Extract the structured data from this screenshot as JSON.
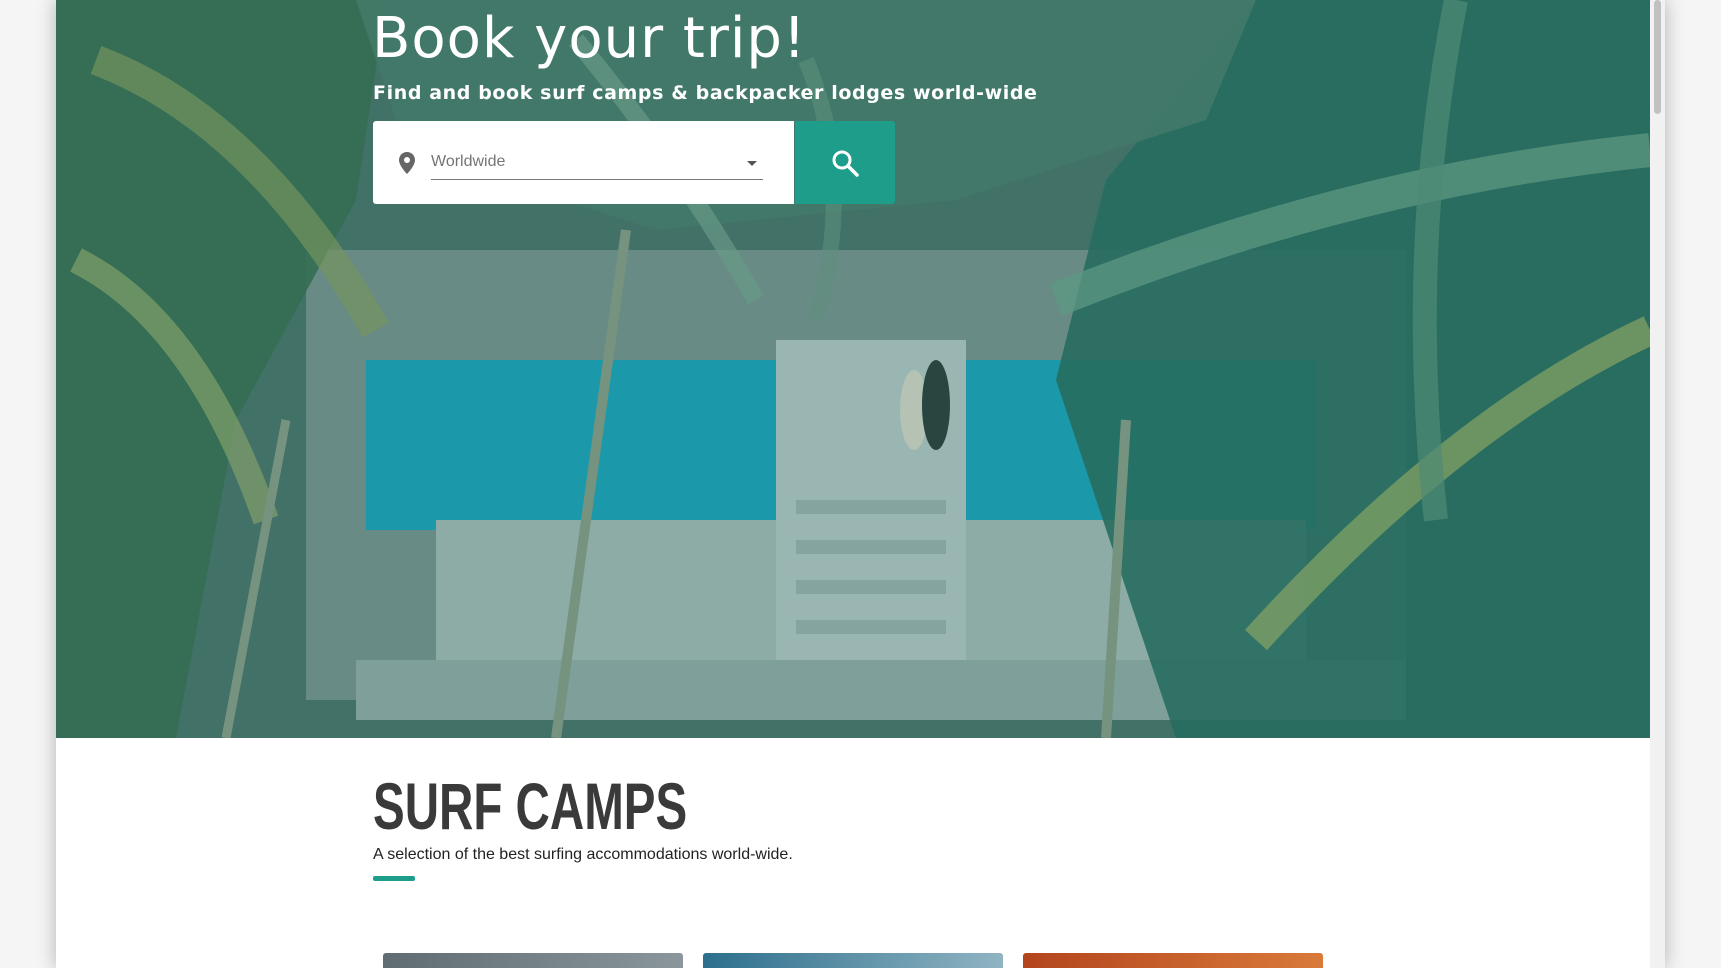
{
  "hero": {
    "title": "Book your trip!",
    "subtitle": "Find and book surf camps & backpacker lodges world-wide"
  },
  "search": {
    "location_value": "Worldwide",
    "pin_icon": "location-pin-icon",
    "dropdown_icon": "caret-down-icon",
    "button_icon": "search-icon"
  },
  "section": {
    "title": "SURF CAMPS",
    "subtitle": "A selection of the best surfing accommodations world-wide."
  },
  "colors": {
    "accent": "#1e9e8a",
    "title_text": "#3a3a3a"
  }
}
